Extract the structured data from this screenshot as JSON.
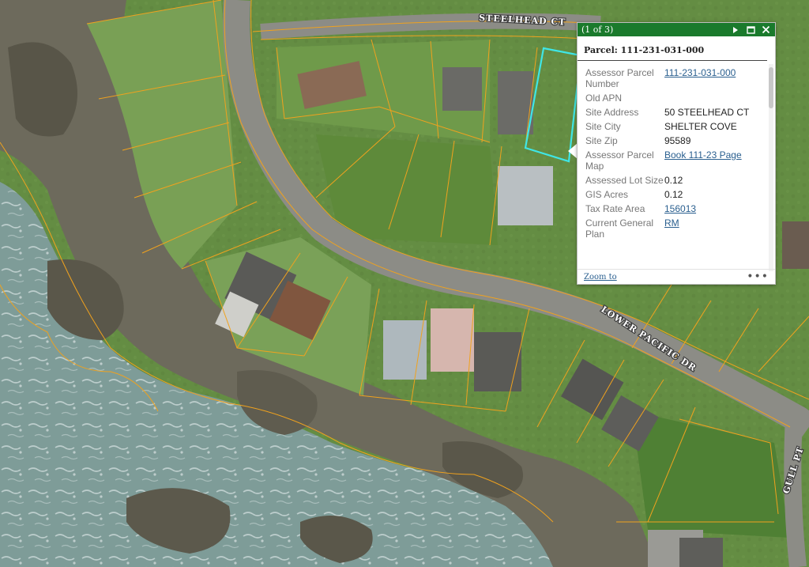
{
  "roads": {
    "steelhead": "STEELHEAD CT",
    "lower_pacific": "LOWER PACIFIC DR",
    "gull": "GULL PT"
  },
  "colors": {
    "parcel_line": "#f0a21e",
    "selected_parcel": "#3fe6e6",
    "popup_header": "#1a7a2c",
    "link": "#2a5f8f"
  },
  "popup": {
    "count": "(1 of 3)",
    "title": "Parcel: 111-231-031-000",
    "rows": [
      {
        "key": "Assessor Parcel Number",
        "value": "111-231-031-000",
        "link": true
      },
      {
        "key": "Old APN",
        "value": "",
        "link": false
      },
      {
        "key": "Site Address",
        "value": "50 STEELHEAD CT",
        "link": false
      },
      {
        "key": "Site City",
        "value": "SHELTER COVE",
        "link": false
      },
      {
        "key": "Site Zip",
        "value": "95589",
        "link": false
      },
      {
        "key": "Assessor Parcel Map",
        "value": "Book 111-23 Page",
        "link": true
      },
      {
        "key": "Assessed Lot Size",
        "value": "0.12",
        "link": false
      },
      {
        "key": "GIS Acres",
        "value": "0.12",
        "link": false
      },
      {
        "key": "Tax Rate Area",
        "value": "156013",
        "link": true
      },
      {
        "key": "Current General Plan",
        "value": "RM",
        "link": true
      }
    ],
    "zoom_label": "Zoom to",
    "more_label": "•••"
  }
}
